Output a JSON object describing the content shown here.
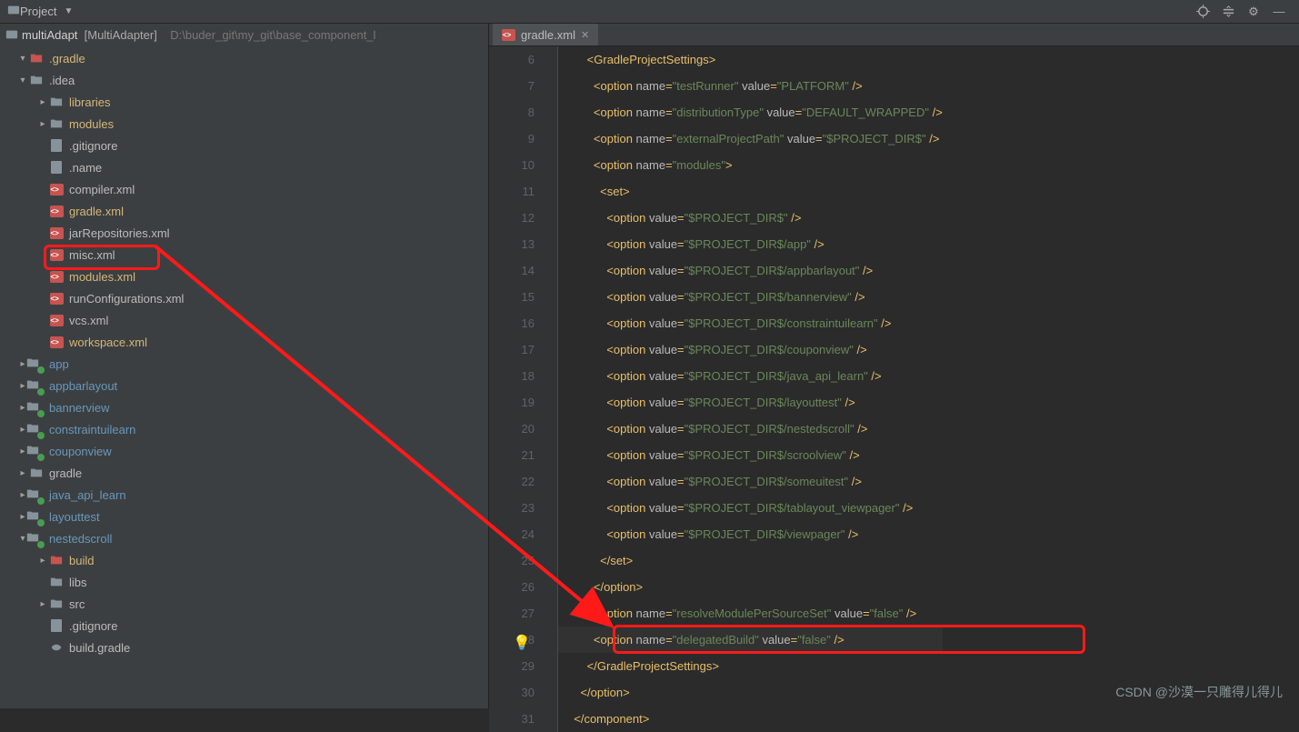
{
  "topbar": {
    "title": "Project"
  },
  "toolicons": [
    "target",
    "collapse",
    "gear",
    "hide"
  ],
  "breadcrumb": {
    "proj": "multiAdapt",
    "bracket": "[MultiAdapter]",
    "path": "D:\\buder_git\\my_git\\base_component_l"
  },
  "tree": [
    {
      "ind": 0,
      "arrow": "▾",
      "icon": "folder-excl",
      "label": ".gradle",
      "cls": "excl"
    },
    {
      "ind": 0,
      "arrow": "▾",
      "icon": "folder",
      "label": ".idea",
      "cls": ""
    },
    {
      "ind": 1,
      "arrow": "▸",
      "icon": "folder-mod",
      "label": "libraries",
      "cls": "hilite"
    },
    {
      "ind": 1,
      "arrow": "▸",
      "icon": "folder-mod",
      "label": "modules",
      "cls": "hilite"
    },
    {
      "ind": 1,
      "arrow": "",
      "icon": "txt",
      "label": ".gitignore",
      "cls": ""
    },
    {
      "ind": 1,
      "arrow": "",
      "icon": "txt",
      "label": ".name",
      "cls": ""
    },
    {
      "ind": 1,
      "arrow": "",
      "icon": "xml",
      "label": "compiler.xml",
      "cls": ""
    },
    {
      "ind": 1,
      "arrow": "",
      "icon": "xml",
      "label": "gradle.xml",
      "cls": "hilite",
      "redbox": true
    },
    {
      "ind": 1,
      "arrow": "",
      "icon": "xml",
      "label": "jarRepositories.xml",
      "cls": ""
    },
    {
      "ind": 1,
      "arrow": "",
      "icon": "xml",
      "label": "misc.xml",
      "cls": ""
    },
    {
      "ind": 1,
      "arrow": "",
      "icon": "xml",
      "label": "modules.xml",
      "cls": "hilite"
    },
    {
      "ind": 1,
      "arrow": "",
      "icon": "xml",
      "label": "runConfigurations.xml",
      "cls": ""
    },
    {
      "ind": 1,
      "arrow": "",
      "icon": "xml",
      "label": "vcs.xml",
      "cls": ""
    },
    {
      "ind": 1,
      "arrow": "",
      "icon": "xml",
      "label": "workspace.xml",
      "cls": "hilite"
    },
    {
      "ind": 0,
      "arrow": "▸",
      "icon": "folder-dot",
      "label": "app",
      "cls": "mod"
    },
    {
      "ind": 0,
      "arrow": "▸",
      "icon": "folder-dot",
      "label": "appbarlayout",
      "cls": "mod"
    },
    {
      "ind": 0,
      "arrow": "▸",
      "icon": "folder-dot",
      "label": "bannerview",
      "cls": "mod"
    },
    {
      "ind": 0,
      "arrow": "▸",
      "icon": "folder-dot",
      "label": "constraintuilearn",
      "cls": "mod"
    },
    {
      "ind": 0,
      "arrow": "▸",
      "icon": "folder-dot",
      "label": "couponview",
      "cls": "mod"
    },
    {
      "ind": 0,
      "arrow": "▸",
      "icon": "folder",
      "label": "gradle",
      "cls": ""
    },
    {
      "ind": 0,
      "arrow": "▸",
      "icon": "folder-dot",
      "label": "java_api_learn",
      "cls": "mod"
    },
    {
      "ind": 0,
      "arrow": "▸",
      "icon": "folder-dot",
      "label": "layouttest",
      "cls": "mod"
    },
    {
      "ind": 0,
      "arrow": "▾",
      "icon": "folder-dot",
      "label": "nestedscroll",
      "cls": "mod"
    },
    {
      "ind": 1,
      "arrow": "▸",
      "icon": "folder-excl",
      "label": "build",
      "cls": "excl"
    },
    {
      "ind": 1,
      "arrow": "",
      "icon": "folder",
      "label": "libs",
      "cls": ""
    },
    {
      "ind": 1,
      "arrow": "▸",
      "icon": "folder",
      "label": "src",
      "cls": ""
    },
    {
      "ind": 1,
      "arrow": "",
      "icon": "txt",
      "label": ".gitignore",
      "cls": ""
    },
    {
      "ind": 1,
      "arrow": "",
      "icon": "gradle",
      "label": "build.gradle",
      "cls": ""
    }
  ],
  "tab": {
    "filename": "gradle.xml"
  },
  "codelines": [
    {
      "n": 6,
      "ind": 3,
      "parts": [
        [
          "tag",
          "<GradleProjectSettings>"
        ]
      ],
      "bg": "box"
    },
    {
      "n": 7,
      "ind": 4,
      "parts": [
        [
          "tag",
          "<option "
        ],
        [
          "attr",
          "name"
        ],
        [
          "tag",
          "="
        ],
        [
          "val",
          "\"testRunner\""
        ],
        [
          "tag",
          " "
        ],
        [
          "attr",
          "value"
        ],
        [
          "tag",
          "="
        ],
        [
          "val",
          "\"PLATFORM\""
        ],
        [
          "tag",
          " />"
        ]
      ]
    },
    {
      "n": 8,
      "ind": 4,
      "parts": [
        [
          "tag",
          "<option "
        ],
        [
          "attr",
          "name"
        ],
        [
          "tag",
          "="
        ],
        [
          "val",
          "\"distributionType\""
        ],
        [
          "tag",
          " "
        ],
        [
          "attr",
          "value"
        ],
        [
          "tag",
          "="
        ],
        [
          "val",
          "\"DEFAULT_WRAPPED\""
        ],
        [
          "tag",
          " />"
        ]
      ]
    },
    {
      "n": 9,
      "ind": 4,
      "parts": [
        [
          "tag",
          "<option "
        ],
        [
          "attr",
          "name"
        ],
        [
          "tag",
          "="
        ],
        [
          "val",
          "\"externalProjectPath\""
        ],
        [
          "tag",
          " "
        ],
        [
          "attr",
          "value"
        ],
        [
          "tag",
          "="
        ],
        [
          "val",
          "\"$PROJECT_DIR$\""
        ],
        [
          "tag",
          " />"
        ]
      ]
    },
    {
      "n": 10,
      "ind": 4,
      "parts": [
        [
          "tag",
          "<option "
        ],
        [
          "attr",
          "name"
        ],
        [
          "tag",
          "="
        ],
        [
          "val",
          "\"modules\""
        ],
        [
          "tag",
          ">"
        ]
      ]
    },
    {
      "n": 11,
      "ind": 5,
      "parts": [
        [
          "tag",
          "<set>"
        ]
      ]
    },
    {
      "n": 12,
      "ind": 6,
      "parts": [
        [
          "tag",
          "<option "
        ],
        [
          "attr",
          "value"
        ],
        [
          "tag",
          "="
        ],
        [
          "val",
          "\"$PROJECT_DIR$\""
        ],
        [
          "tag",
          " />"
        ]
      ]
    },
    {
      "n": 13,
      "ind": 6,
      "parts": [
        [
          "tag",
          "<option "
        ],
        [
          "attr",
          "value"
        ],
        [
          "tag",
          "="
        ],
        [
          "val",
          "\"$PROJECT_DIR$/app\""
        ],
        [
          "tag",
          " />"
        ]
      ]
    },
    {
      "n": 14,
      "ind": 6,
      "parts": [
        [
          "tag",
          "<option "
        ],
        [
          "attr",
          "value"
        ],
        [
          "tag",
          "="
        ],
        [
          "val",
          "\"$PROJECT_DIR$/appbarlayout\""
        ],
        [
          "tag",
          " />"
        ]
      ]
    },
    {
      "n": 15,
      "ind": 6,
      "parts": [
        [
          "tag",
          "<option "
        ],
        [
          "attr",
          "value"
        ],
        [
          "tag",
          "="
        ],
        [
          "val",
          "\"$PROJECT_DIR$/bannerview\""
        ],
        [
          "tag",
          " />"
        ]
      ]
    },
    {
      "n": 16,
      "ind": 6,
      "parts": [
        [
          "tag",
          "<option "
        ],
        [
          "attr",
          "value"
        ],
        [
          "tag",
          "="
        ],
        [
          "val",
          "\"$PROJECT_DIR$/constraintuilearn\""
        ],
        [
          "tag",
          " />"
        ]
      ]
    },
    {
      "n": 17,
      "ind": 6,
      "parts": [
        [
          "tag",
          "<option "
        ],
        [
          "attr",
          "value"
        ],
        [
          "tag",
          "="
        ],
        [
          "val",
          "\"$PROJECT_DIR$/couponview\""
        ],
        [
          "tag",
          " />"
        ]
      ]
    },
    {
      "n": 18,
      "ind": 6,
      "parts": [
        [
          "tag",
          "<option "
        ],
        [
          "attr",
          "value"
        ],
        [
          "tag",
          "="
        ],
        [
          "val",
          "\"$PROJECT_DIR$/java_api_learn\""
        ],
        [
          "tag",
          " />"
        ]
      ]
    },
    {
      "n": 19,
      "ind": 6,
      "parts": [
        [
          "tag",
          "<option "
        ],
        [
          "attr",
          "value"
        ],
        [
          "tag",
          "="
        ],
        [
          "val",
          "\"$PROJECT_DIR$/layouttest\""
        ],
        [
          "tag",
          " />"
        ]
      ]
    },
    {
      "n": 20,
      "ind": 6,
      "parts": [
        [
          "tag",
          "<option "
        ],
        [
          "attr",
          "value"
        ],
        [
          "tag",
          "="
        ],
        [
          "val",
          "\"$PROJECT_DIR$/nestedscroll\""
        ],
        [
          "tag",
          " />"
        ]
      ]
    },
    {
      "n": 21,
      "ind": 6,
      "parts": [
        [
          "tag",
          "<option "
        ],
        [
          "attr",
          "value"
        ],
        [
          "tag",
          "="
        ],
        [
          "val",
          "\"$PROJECT_DIR$/scroolview\""
        ],
        [
          "tag",
          " />"
        ]
      ]
    },
    {
      "n": 22,
      "ind": 6,
      "parts": [
        [
          "tag",
          "<option "
        ],
        [
          "attr",
          "value"
        ],
        [
          "tag",
          "="
        ],
        [
          "val",
          "\"$PROJECT_DIR$/someuitest\""
        ],
        [
          "tag",
          " />"
        ]
      ]
    },
    {
      "n": 23,
      "ind": 6,
      "parts": [
        [
          "tag",
          "<option "
        ],
        [
          "attr",
          "value"
        ],
        [
          "tag",
          "="
        ],
        [
          "val",
          "\"$PROJECT_DIR$/tablayout_viewpager\""
        ],
        [
          "tag",
          " />"
        ]
      ]
    },
    {
      "n": 24,
      "ind": 6,
      "parts": [
        [
          "tag",
          "<option "
        ],
        [
          "attr",
          "value"
        ],
        [
          "tag",
          "="
        ],
        [
          "val",
          "\"$PROJECT_DIR$/viewpager\""
        ],
        [
          "tag",
          " />"
        ]
      ]
    },
    {
      "n": 25,
      "ind": 5,
      "parts": [
        [
          "tag",
          "</set>"
        ]
      ]
    },
    {
      "n": 26,
      "ind": 4,
      "parts": [
        [
          "tag",
          "</option>"
        ]
      ]
    },
    {
      "n": 27,
      "ind": 4,
      "parts": [
        [
          "tag",
          "<option "
        ],
        [
          "attr",
          "name"
        ],
        [
          "tag",
          "="
        ],
        [
          "val",
          "\"resolveModulePerSourceSet\""
        ],
        [
          "tag",
          " "
        ],
        [
          "attr",
          "value"
        ],
        [
          "tag",
          "="
        ],
        [
          "val",
          "\"false\""
        ],
        [
          "tag",
          " />"
        ]
      ]
    },
    {
      "n": 28,
      "ind": 4,
      "parts": [
        [
          "tag",
          "<option "
        ],
        [
          "attr",
          "name"
        ],
        [
          "tag",
          "="
        ],
        [
          "val",
          "\"delegatedBuild\""
        ],
        [
          "tag",
          " "
        ],
        [
          "attr",
          "value"
        ],
        [
          "tag",
          "="
        ],
        [
          "val",
          "\"false\""
        ],
        [
          "tag",
          " />"
        ]
      ],
      "hl": true,
      "redbox": true,
      "bulb": true
    },
    {
      "n": 29,
      "ind": 3,
      "parts": [
        [
          "tag",
          "</GradleProjectSettings>"
        ]
      ]
    },
    {
      "n": 30,
      "ind": 2,
      "parts": [
        [
          "tag",
          "</option>"
        ]
      ]
    },
    {
      "n": 31,
      "ind": 1,
      "parts": [
        [
          "tag",
          "</component>"
        ]
      ],
      "cut": true
    }
  ],
  "watermark": "CSDN @沙漠一只雕得儿得儿"
}
